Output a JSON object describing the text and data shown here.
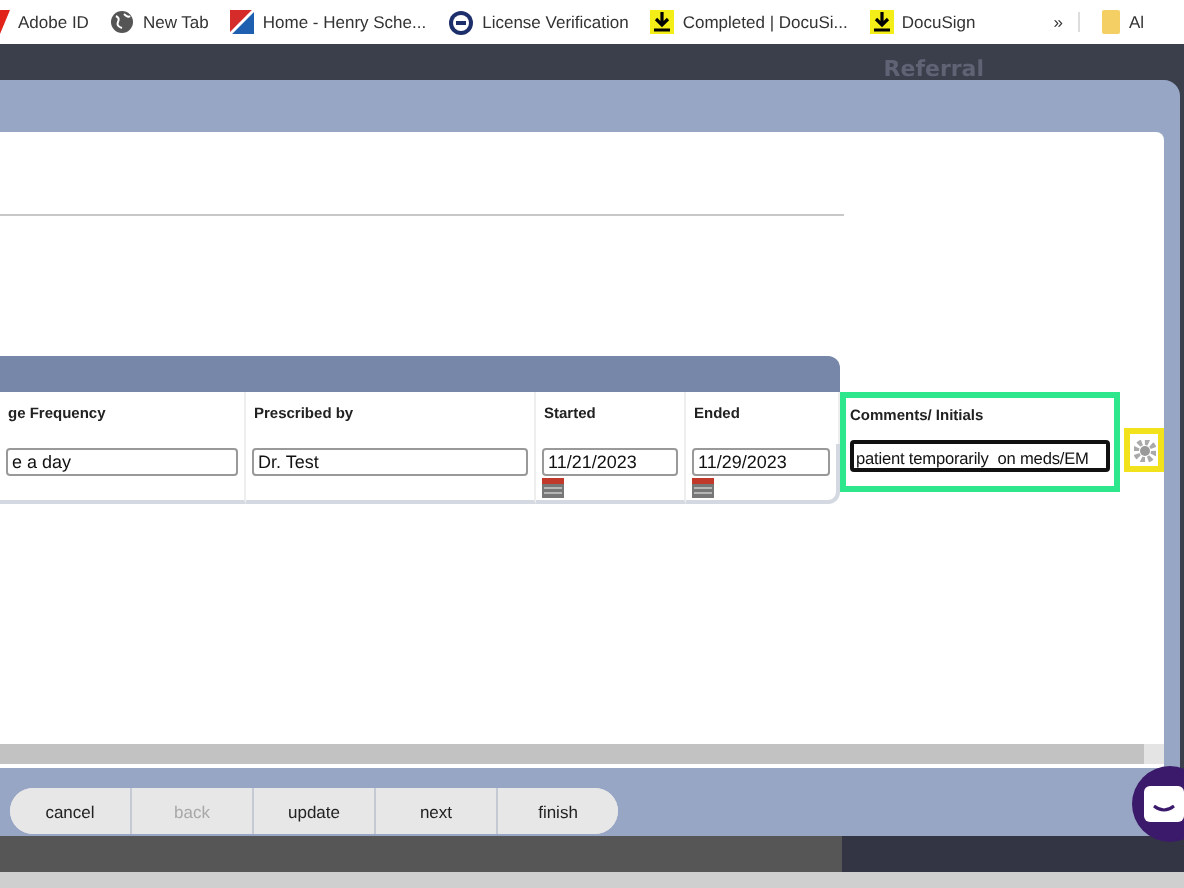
{
  "bookmarks": [
    {
      "label": "Adobe ID",
      "kind": "adobe"
    },
    {
      "label": "New Tab",
      "kind": "globe"
    },
    {
      "label": "Home - Henry Sche...",
      "kind": "flag"
    },
    {
      "label": "License Verification",
      "kind": "seal"
    },
    {
      "label": "Completed | DocuSi...",
      "kind": "download"
    },
    {
      "label": "DocuSign",
      "kind": "download"
    },
    {
      "label": "»",
      "kind": "overflow"
    },
    {
      "label": "Al",
      "kind": "folder"
    }
  ],
  "background_tab": "Referral",
  "table": {
    "columns": [
      "ge Frequency",
      "Prescribed by",
      "Started",
      "Ended",
      "Comments/ Initials"
    ],
    "row": [
      {
        "kind": "text",
        "value": "e a day"
      },
      {
        "kind": "text",
        "value": "Dr. Test"
      },
      {
        "kind": "date",
        "value": "11/21/2023"
      },
      {
        "kind": "date",
        "value": "11/29/2023"
      },
      {
        "kind": "comment",
        "value": "patient temporarily  on meds/EM"
      }
    ]
  },
  "buttons": [
    {
      "label": "cancel",
      "disabled": false
    },
    {
      "label": "back",
      "disabled": true
    },
    {
      "label": "update",
      "disabled": false
    },
    {
      "label": "next",
      "disabled": false
    },
    {
      "label": "finish",
      "disabled": false
    }
  ]
}
